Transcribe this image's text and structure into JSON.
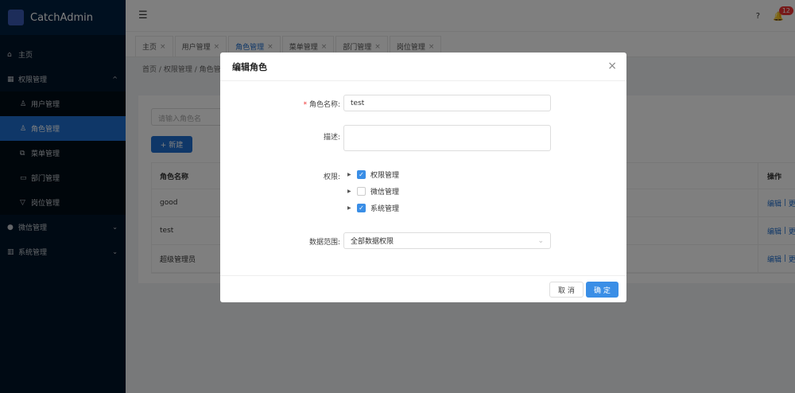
{
  "app": {
    "title": "CatchAdmin"
  },
  "sidebar": {
    "items": [
      {
        "label": "主页",
        "icon": "home-icon"
      },
      {
        "label": "权限管理",
        "icon": "grid-icon",
        "expanded": true
      },
      {
        "label": "用户管理",
        "icon": "user-icon"
      },
      {
        "label": "角色管理",
        "icon": "role-icon",
        "active": true
      },
      {
        "label": "菜单管理",
        "icon": "menu-icon"
      },
      {
        "label": "部门管理",
        "icon": "monitor-icon"
      },
      {
        "label": "岗位管理",
        "icon": "shirt-icon"
      },
      {
        "label": "微信管理",
        "icon": "wechat-icon"
      },
      {
        "label": "系统管理",
        "icon": "chart-icon"
      }
    ]
  },
  "header": {
    "notification_count": "12"
  },
  "tabs": [
    {
      "label": "主页"
    },
    {
      "label": "用户管理"
    },
    {
      "label": "角色管理",
      "active": true
    },
    {
      "label": "菜单管理"
    },
    {
      "label": "部门管理"
    },
    {
      "label": "岗位管理"
    }
  ],
  "breadcrumb": {
    "items": [
      "首页",
      "权限管理",
      "角色管理"
    ],
    "sep": "/"
  },
  "page": {
    "search_placeholder": "请输入角色名",
    "new_label": "+ 新建",
    "table": {
      "headers": [
        "角色名称",
        "操作"
      ],
      "rows": [
        "good",
        "test",
        "超级管理员"
      ],
      "edit": "编辑",
      "more": "更多"
    }
  },
  "modal": {
    "title": "编辑角色",
    "name_label": "角色名称:",
    "name_value": "test",
    "desc_label": "描述:",
    "perm_label": "权限:",
    "perms": [
      {
        "label": "权限管理",
        "checked": true
      },
      {
        "label": "微信管理",
        "checked": false
      },
      {
        "label": "系统管理",
        "checked": true
      }
    ],
    "scope_label": "数据范围:",
    "scope_value": "全部数据权限",
    "cancel": "取 消",
    "confirm": "确 定"
  }
}
